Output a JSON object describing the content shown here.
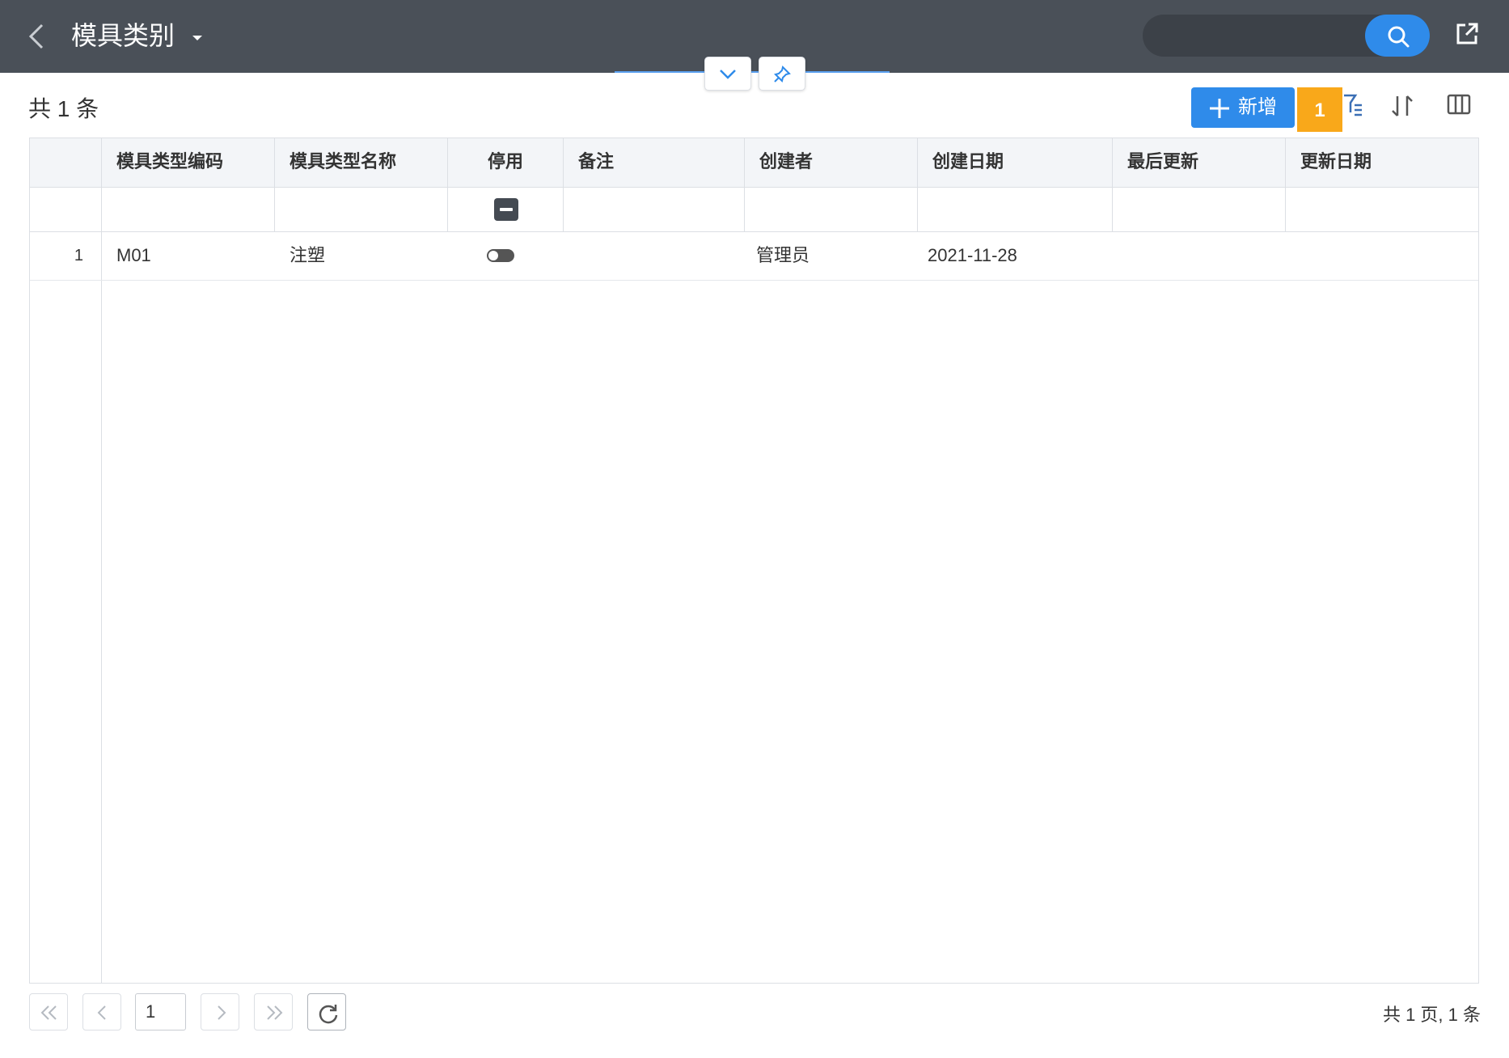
{
  "header": {
    "title": "模具类别",
    "search_placeholder": ""
  },
  "toolbar": {
    "count_text": "共 1 条",
    "add_label": "新增",
    "badge": "1"
  },
  "grid": {
    "columns": [
      "模具类型编码",
      "模具类型名称",
      "停用",
      "备注",
      "创建者",
      "创建日期",
      "最后更新",
      "更新日期"
    ],
    "rows": [
      {
        "index": "1",
        "code": "M01",
        "name": "注塑",
        "disabled": false,
        "remark": "",
        "creator": "管理员",
        "created": "2021-11-28",
        "last_update": "",
        "updated": ""
      }
    ]
  },
  "pager": {
    "current_page": "1",
    "summary": "共 1 页, 1 条"
  },
  "colors": {
    "topbar": "#4a5058",
    "accent": "#2f8bea",
    "badge": "#f9a81a",
    "link": "#2f7ed8"
  },
  "icons": [
    "back-icon",
    "dropdown-caret-icon",
    "search-icon",
    "share-icon",
    "chevron-down-icon",
    "pin-icon",
    "plus-icon",
    "filter-icon",
    "sort-icon",
    "columns-icon",
    "first-page-icon",
    "prev-page-icon",
    "next-page-icon",
    "last-page-icon",
    "refresh-icon"
  ]
}
